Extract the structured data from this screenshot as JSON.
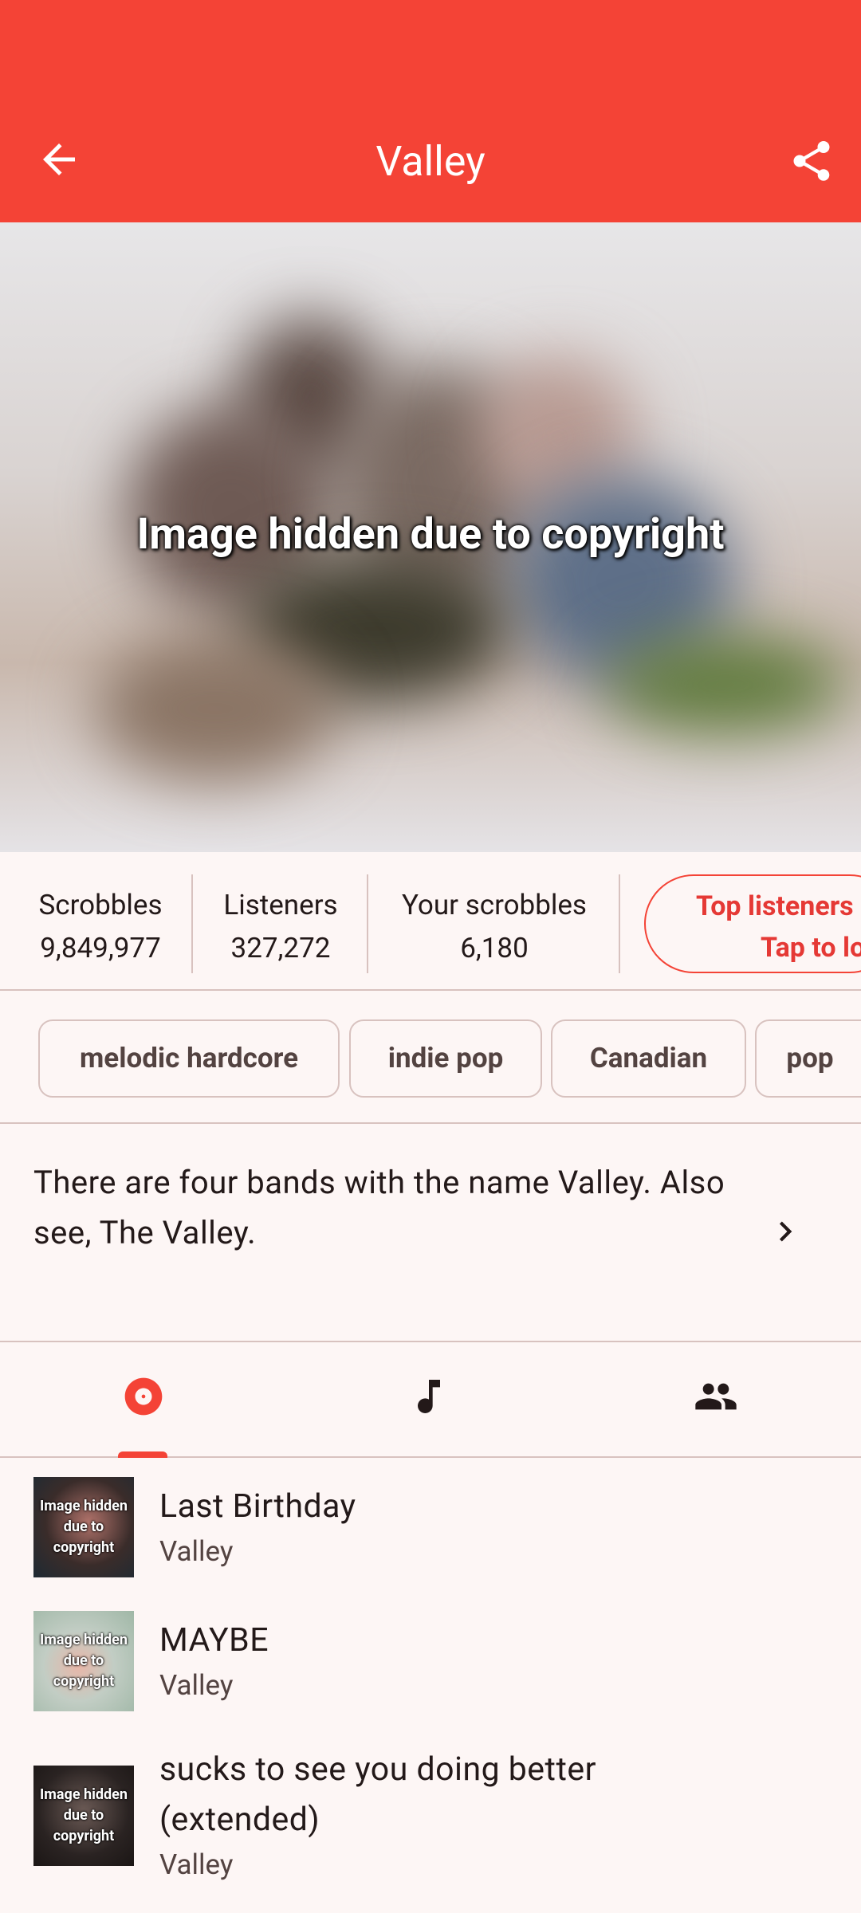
{
  "app_bar": {
    "title": "Valley",
    "back_icon": "arrow-back-icon",
    "share_icon": "share-icon",
    "color": "#f44336"
  },
  "hero": {
    "overlay_text": "Image hidden due to copyright"
  },
  "stats": [
    {
      "label": "Scrobbles",
      "value": "9,849,977"
    },
    {
      "label": "Listeners",
      "value": "327,272"
    },
    {
      "label": "Your scrobbles",
      "value": "6,180"
    }
  ],
  "top_listeners": {
    "line1": "Top listeners",
    "line2": "Tap to lo"
  },
  "tags": [
    "melodic hardcore",
    "indie pop",
    "Canadian",
    "pop"
  ],
  "bio": {
    "text": "There are four bands with the name Valley. Also see, The Valley.",
    "chevron_icon": "chevron-right-icon"
  },
  "tabs": [
    {
      "icon": "album-icon",
      "selected": true
    },
    {
      "icon": "music-note-icon",
      "selected": false
    },
    {
      "icon": "people-icon",
      "selected": false
    }
  ],
  "tracks": [
    {
      "title": "Last Birthday",
      "artist": "Valley",
      "thumb_text": "Image hidden due to copyright"
    },
    {
      "title": "MAYBE",
      "artist": "Valley",
      "thumb_text": "Image hidden due to copyright"
    },
    {
      "title": "sucks to see you doing better (extended)",
      "artist": "Valley",
      "thumb_text": "Image hidden due to copyright"
    }
  ]
}
